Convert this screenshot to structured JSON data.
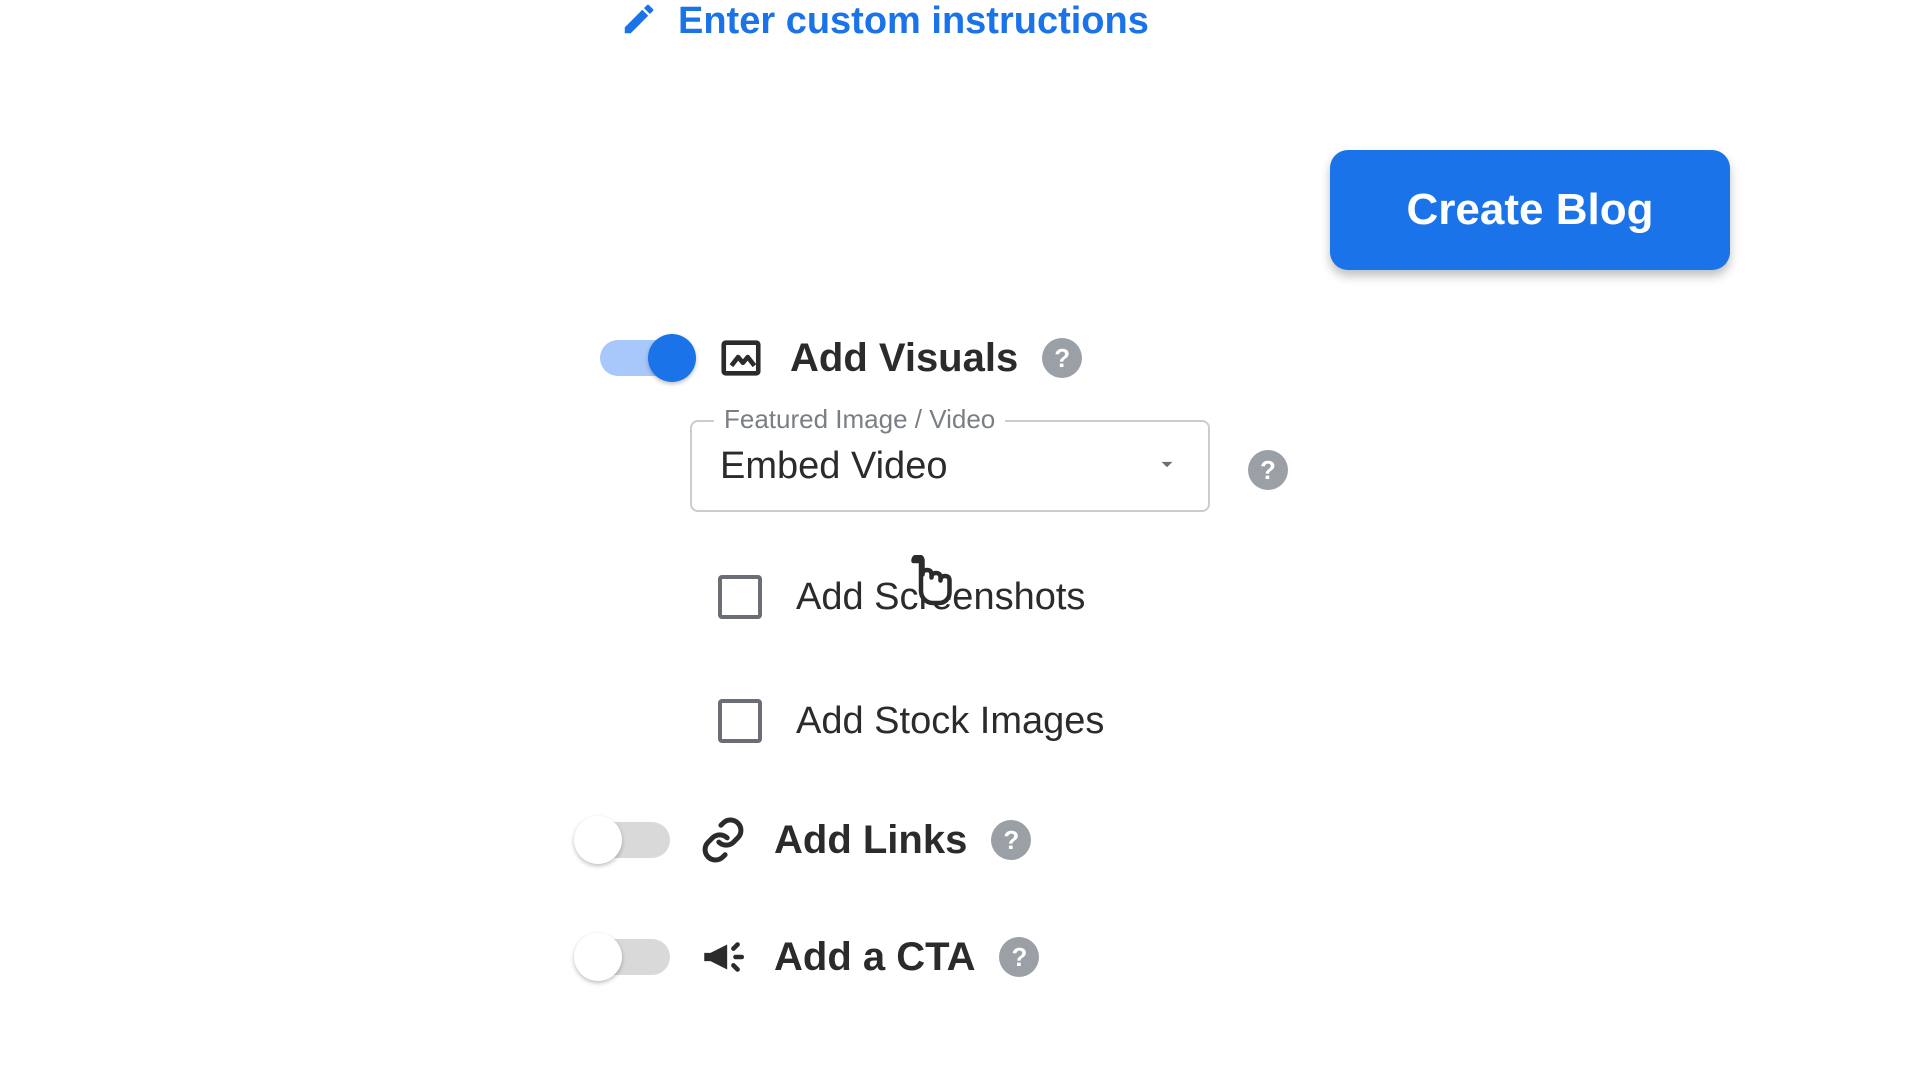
{
  "custom_instructions": {
    "label": "Enter custom instructions"
  },
  "create_button": {
    "label": "Create Blog"
  },
  "visuals": {
    "label": "Add Visuals",
    "select_legend": "Featured Image / Video",
    "select_value": "Embed Video",
    "screenshot_label": "Add Screenshots",
    "stock_label": "Add Stock Images",
    "toggle_on": true
  },
  "links": {
    "label": "Add Links",
    "toggle_on": false
  },
  "cta": {
    "label": "Add a CTA",
    "toggle_on": false
  },
  "help_glyph": "?"
}
